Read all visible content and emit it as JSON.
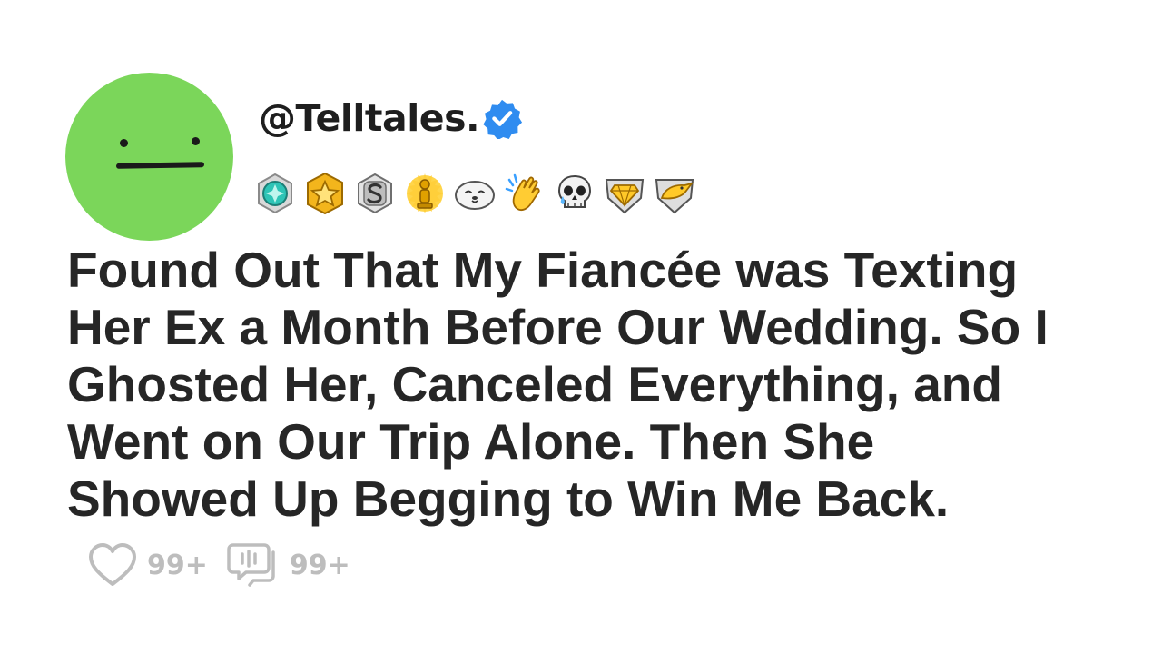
{
  "post": {
    "handle": "@Telltales.",
    "verified": true,
    "badges": [
      "teal-gem-medal-icon",
      "gold-star-medal-icon",
      "silver-s-medal-icon",
      "gold-trophy-figure-icon",
      "seal-face-icon",
      "clapping-hands-icon",
      "crying-skull-icon",
      "gold-diamond-shield-icon",
      "gold-bird-shield-icon"
    ],
    "title": "Found Out That My Fiancée was Texting\nHer Ex a Month Before Our Wedding. So I\nGhosted Her, Canceled Everything, and\nWent on Our Trip Alone. Then She\nShowed Up Begging to Win Me Back.",
    "likes": "99+",
    "comments": "99+"
  },
  "colors": {
    "avatar": "#7bd65a",
    "verified": "#2f8cf0",
    "text": "#262626",
    "muted": "#bdbdbd"
  }
}
